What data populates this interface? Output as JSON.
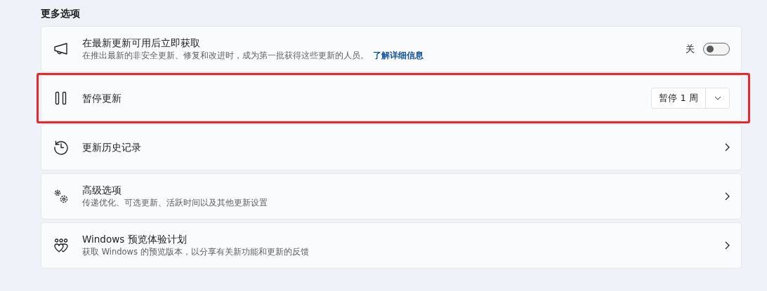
{
  "section_title": "更多选项",
  "items": [
    {
      "kind": "toggle",
      "title": "在最新更新可用后立即获取",
      "description": "在推出最新的非安全更新、修复和改进时，成为第一批获得这些更新的人员。",
      "link": "了解详细信息",
      "toggle_label": "关",
      "on": false,
      "highlighted": false
    },
    {
      "kind": "dropdown",
      "title": "暂停更新",
      "dropdown_value": "暂停 1 周",
      "highlighted": true
    },
    {
      "kind": "chevron",
      "title": "更新历史记录",
      "highlighted": false
    },
    {
      "kind": "chevron",
      "title": "高级选项",
      "description": "传递优化、可选更新、活跃时间以及其他更新设置",
      "highlighted": false
    },
    {
      "kind": "chevron",
      "title": "Windows 预览体验计划",
      "description": "获取 Windows 的预览版本，以分享有关新功能和更新的反馈",
      "highlighted": false
    }
  ]
}
